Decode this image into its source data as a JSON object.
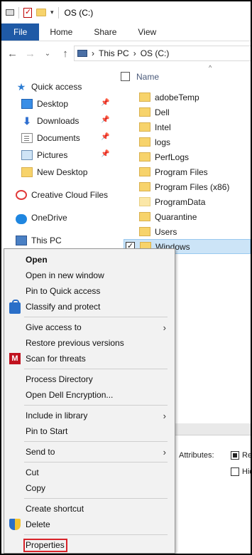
{
  "window": {
    "title": "OS (C:)"
  },
  "ribbon": {
    "tabs": [
      "File",
      "Home",
      "Share",
      "View"
    ]
  },
  "address": {
    "breadcrumb": [
      "This PC",
      "OS (C:)"
    ],
    "separators": [
      "›",
      "›"
    ]
  },
  "nav": {
    "items": [
      {
        "label": "Quick access",
        "icon": "star-icon"
      },
      {
        "label": "Desktop",
        "icon": "desktop-icon",
        "pinned": true
      },
      {
        "label": "Downloads",
        "icon": "download-icon",
        "pinned": true
      },
      {
        "label": "Documents",
        "icon": "document-icon",
        "pinned": true
      },
      {
        "label": "Pictures",
        "icon": "pictures-icon",
        "pinned": true
      },
      {
        "label": "New Desktop",
        "icon": "folder-icon"
      },
      {
        "label": "Creative Cloud Files",
        "icon": "creative-cloud-icon"
      },
      {
        "label": "OneDrive",
        "icon": "onedrive-icon"
      },
      {
        "label": "This PC",
        "icon": "this-pc-icon"
      }
    ],
    "pin_glyph": "📌"
  },
  "content": {
    "column_name": "Name",
    "files": [
      "adobeTemp",
      "Dell",
      "Intel",
      "logs",
      "PerfLogs",
      "Program Files",
      "Program Files (x86)",
      "ProgramData",
      "Quarantine",
      "Users",
      "Windows"
    ],
    "selected": "Windows",
    "attributes_label": "Attributes:",
    "attr_options": [
      "Re",
      "Hid"
    ]
  },
  "context_menu": {
    "items": [
      {
        "label": "Open",
        "bold": true
      },
      {
        "label": "Open in new window"
      },
      {
        "label": "Pin to Quick access"
      },
      {
        "label": "Classify and protect",
        "icon": "lock-icon"
      },
      {
        "label": "Give access to",
        "submenu": true
      },
      {
        "label": "Restore previous versions"
      },
      {
        "label": "Scan for threats",
        "icon": "mcafee-icon"
      },
      {
        "label": "Process Directory"
      },
      {
        "label": "Open Dell Encryption..."
      },
      {
        "label": "Include in library",
        "submenu": true
      },
      {
        "label": "Pin to Start"
      },
      {
        "label": "Send to",
        "submenu": true
      },
      {
        "label": "Cut"
      },
      {
        "label": "Copy"
      },
      {
        "label": "Create shortcut"
      },
      {
        "label": "Delete",
        "icon": "shield-icon"
      },
      {
        "label": "Properties",
        "highlighted": true
      }
    ],
    "submenu_glyph": "›",
    "highlight_color": "#d8232a"
  }
}
